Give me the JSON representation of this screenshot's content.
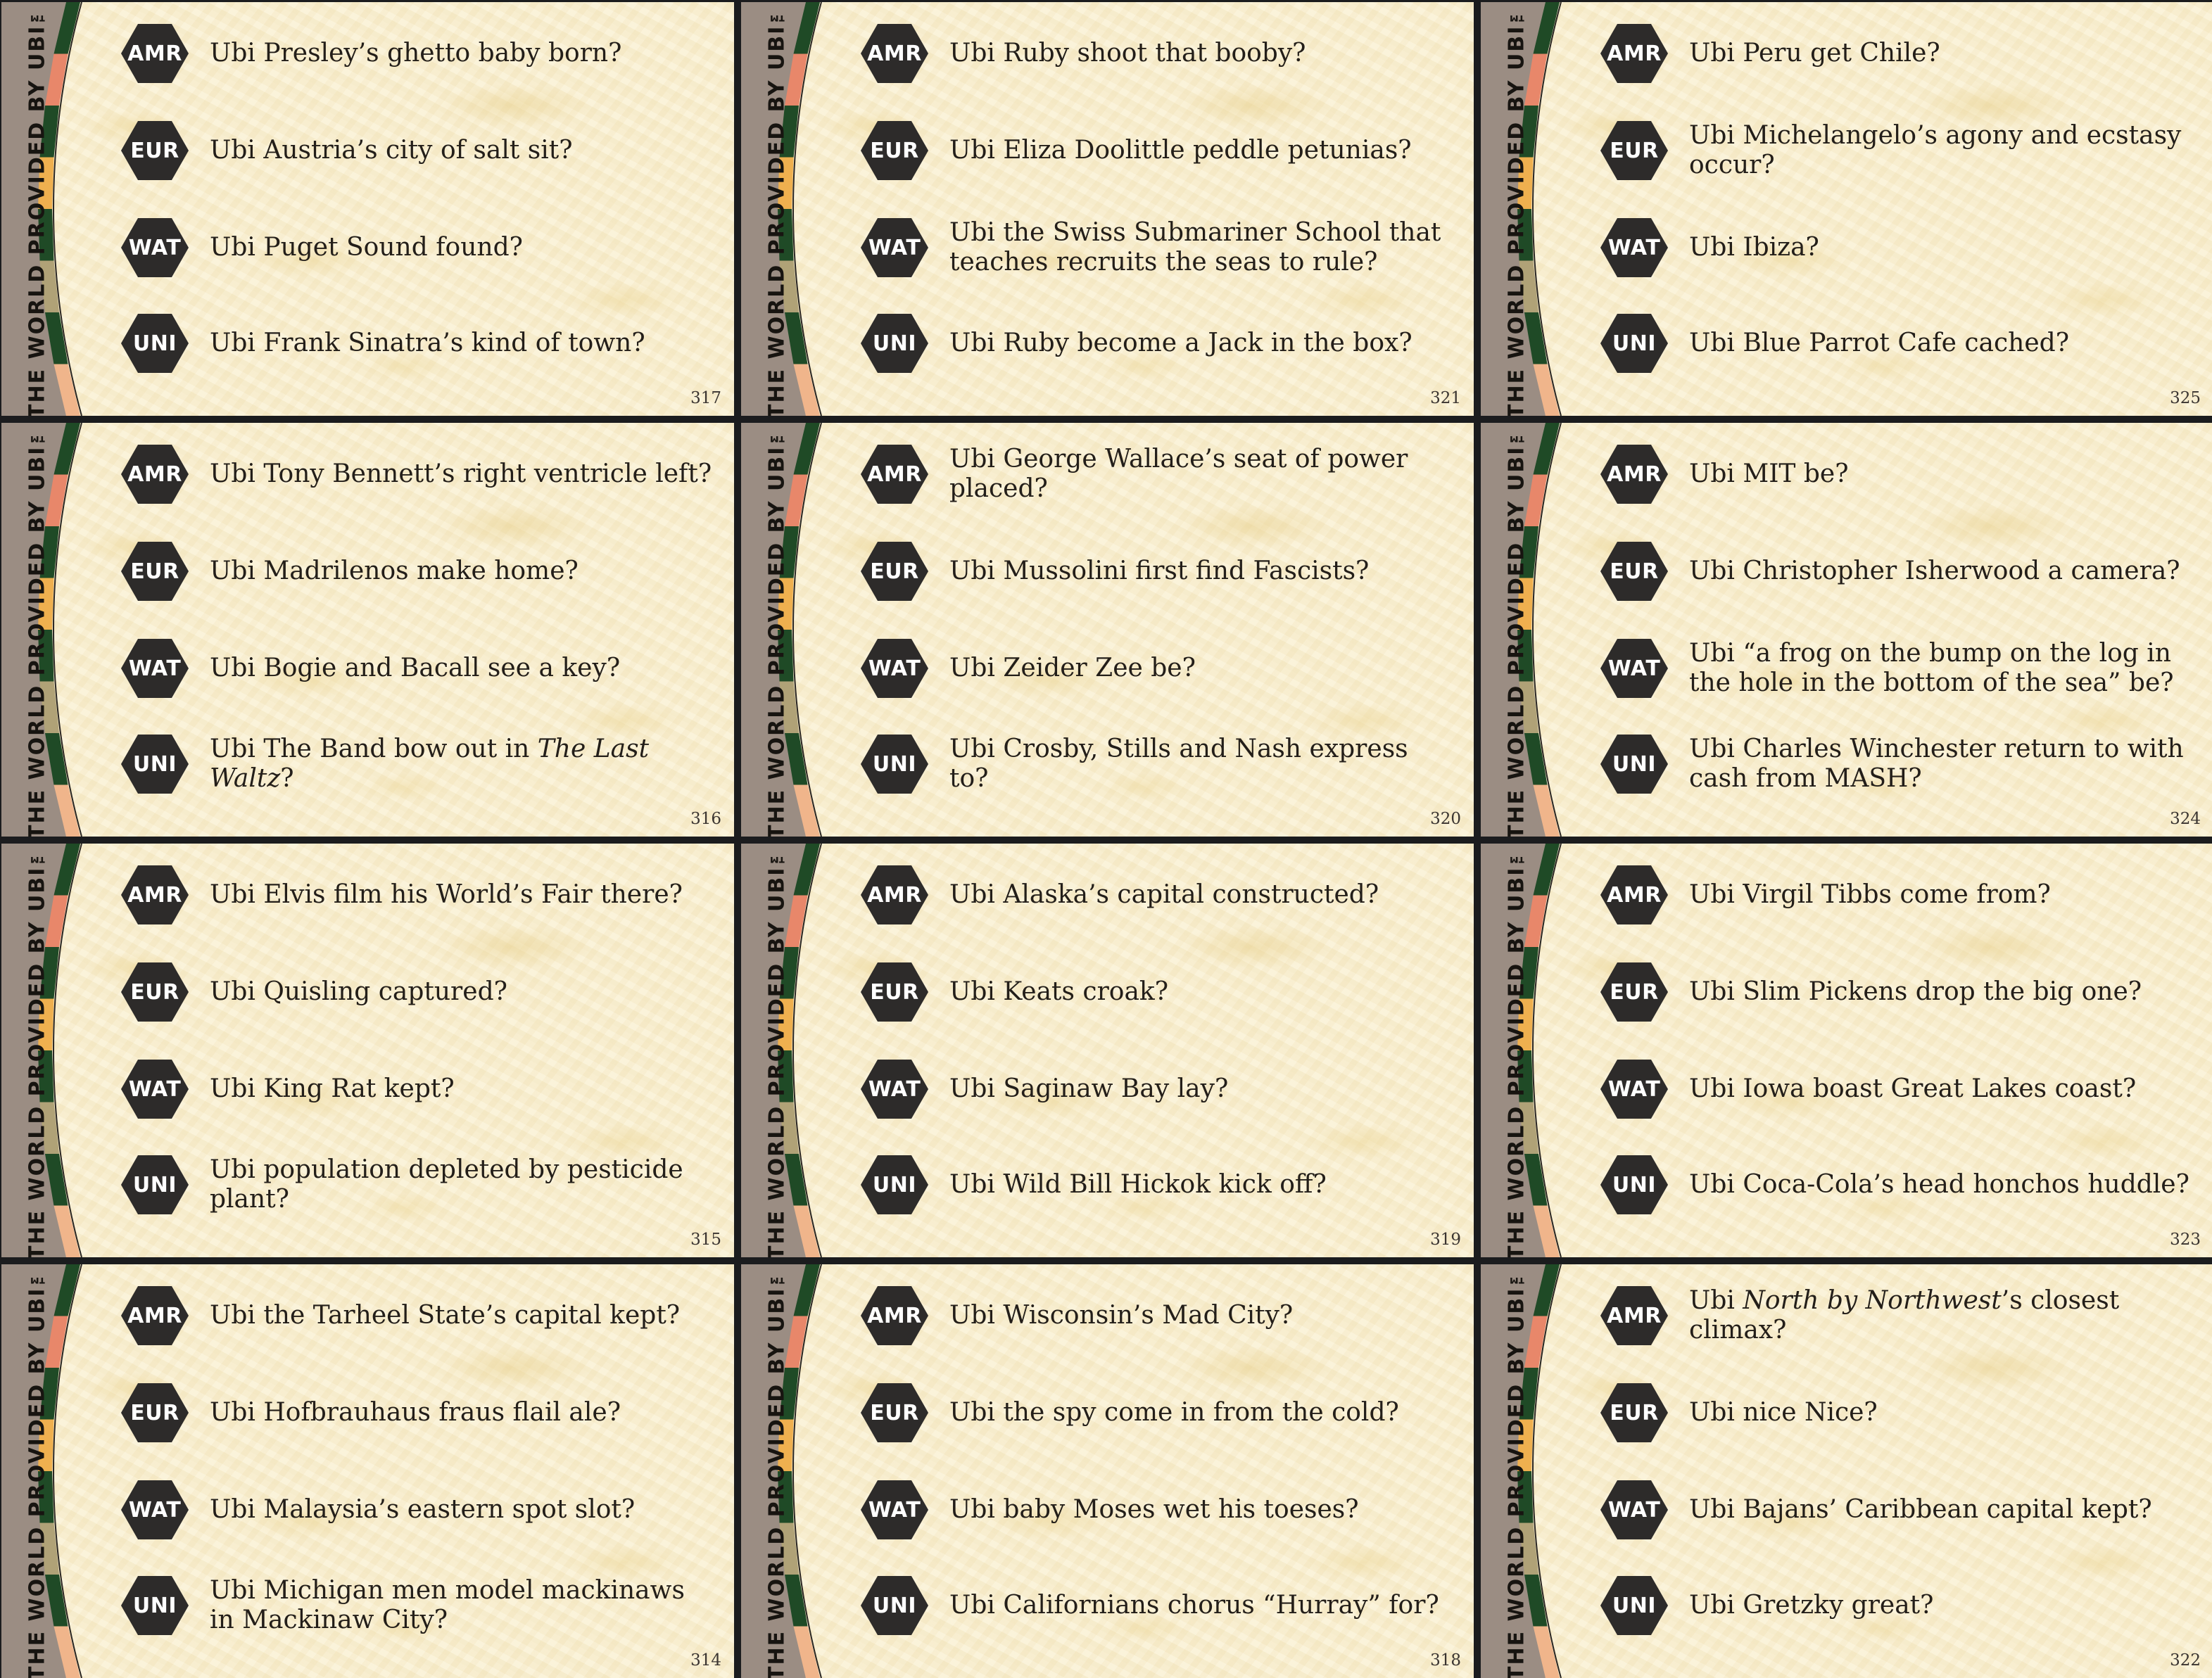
{
  "spine_title": "THE WORLD PROVIDED BY UBI™",
  "category_codes": [
    "AMR",
    "EUR",
    "WAT",
    "UNI"
  ],
  "colors": {
    "spine_brown": "#9b8d83",
    "band_green": "#1f4a26",
    "band_salmon": "#e8876a",
    "band_orange": "#efb04f",
    "band_khaki": "#b0a277",
    "band_peach": "#f0b58b",
    "hex_fill": "#2d2b2a",
    "card_bg": "#faf1d6"
  },
  "cards": [
    {
      "number": "317",
      "questions": [
        {
          "code": "AMR",
          "text": "Ubi Presley’s ghetto baby born?"
        },
        {
          "code": "EUR",
          "text": "Ubi Austria’s city of salt sit?"
        },
        {
          "code": "WAT",
          "text": "Ubi Puget Sound found?"
        },
        {
          "code": "UNI",
          "text": "Ubi Frank Sinatra’s kind of town?"
        }
      ]
    },
    {
      "number": "321",
      "questions": [
        {
          "code": "AMR",
          "text": "Ubi Ruby shoot that booby?"
        },
        {
          "code": "EUR",
          "text": "Ubi Eliza Doolittle peddle petunias?"
        },
        {
          "code": "WAT",
          "text": "Ubi the Swiss Submariner School that teaches recruits the seas to rule?"
        },
        {
          "code": "UNI",
          "text": "Ubi Ruby become a Jack in the box?"
        }
      ]
    },
    {
      "number": "325",
      "questions": [
        {
          "code": "AMR",
          "text": "Ubi Peru get Chile?"
        },
        {
          "code": "EUR",
          "text": "Ubi Michelangelo’s agony and ecstasy occur?"
        },
        {
          "code": "WAT",
          "text": "Ubi Ibiza?"
        },
        {
          "code": "UNI",
          "text": "Ubi Blue Parrot Cafe cached?"
        }
      ]
    },
    {
      "number": "316",
      "questions": [
        {
          "code": "AMR",
          "text": "Ubi Tony Bennett’s right ventricle left?"
        },
        {
          "code": "EUR",
          "text": "Ubi Madrilenos make home?"
        },
        {
          "code": "WAT",
          "text": "Ubi Bogie and Bacall see a key?"
        },
        {
          "code": "UNI",
          "text": "Ubi The Band bow out in The Last Waltz?",
          "italic": "The Last Waltz"
        }
      ]
    },
    {
      "number": "320",
      "questions": [
        {
          "code": "AMR",
          "text": "Ubi George Wallace’s seat of power placed?"
        },
        {
          "code": "EUR",
          "text": "Ubi Mussolini first find Fascists?"
        },
        {
          "code": "WAT",
          "text": "Ubi Zeider Zee be?"
        },
        {
          "code": "UNI",
          "text": "Ubi Crosby, Stills and Nash express to?"
        }
      ]
    },
    {
      "number": "324",
      "questions": [
        {
          "code": "AMR",
          "text": "Ubi MIT be?"
        },
        {
          "code": "EUR",
          "text": "Ubi Christopher Isherwood a camera?"
        },
        {
          "code": "WAT",
          "text": "Ubi “a frog on the bump on the log  in the hole in the bottom of the sea” be?"
        },
        {
          "code": "UNI",
          "text": "Ubi Charles Winchester return to with cash from MASH?"
        }
      ]
    },
    {
      "number": "315",
      "questions": [
        {
          "code": "AMR",
          "text": "Ubi Elvis film his World’s Fair there?"
        },
        {
          "code": "EUR",
          "text": "Ubi Quisling captured?"
        },
        {
          "code": "WAT",
          "text": "Ubi King Rat kept?"
        },
        {
          "code": "UNI",
          "text": "Ubi population depleted by pesticide plant?"
        }
      ]
    },
    {
      "number": "319",
      "questions": [
        {
          "code": "AMR",
          "text": "Ubi Alaska’s capital constructed?"
        },
        {
          "code": "EUR",
          "text": "Ubi Keats croak?"
        },
        {
          "code": "WAT",
          "text": "Ubi Saginaw Bay lay?"
        },
        {
          "code": "UNI",
          "text": "Ubi Wild Bill Hickok kick off?"
        }
      ]
    },
    {
      "number": "323",
      "questions": [
        {
          "code": "AMR",
          "text": "Ubi Virgil Tibbs come from?"
        },
        {
          "code": "EUR",
          "text": "Ubi Slim Pickens drop the big one?"
        },
        {
          "code": "WAT",
          "text": "Ubi Iowa boast Great Lakes coast?"
        },
        {
          "code": "UNI",
          "text": "Ubi Coca-Cola’s head honchos huddle?"
        }
      ]
    },
    {
      "number": "314",
      "questions": [
        {
          "code": "AMR",
          "text": "Ubi the Tarheel State’s capital kept?"
        },
        {
          "code": "EUR",
          "text": "Ubi Hofbrauhaus fraus flail ale?"
        },
        {
          "code": "WAT",
          "text": "Ubi Malaysia’s eastern spot slot?"
        },
        {
          "code": "UNI",
          "text": "Ubi Michigan men model mackinaws in Mackinaw City?"
        }
      ]
    },
    {
      "number": "318",
      "questions": [
        {
          "code": "AMR",
          "text": "Ubi Wisconsin’s Mad City?"
        },
        {
          "code": "EUR",
          "text": "Ubi the spy come in from the cold?"
        },
        {
          "code": "WAT",
          "text": "Ubi baby Moses wet his toeses?"
        },
        {
          "code": "UNI",
          "text": "Ubi Californians chorus “Hurray” for?"
        }
      ]
    },
    {
      "number": "322",
      "questions": [
        {
          "code": "AMR",
          "text": "Ubi North by Northwest’s closest climax?",
          "italic": "North by Northwest"
        },
        {
          "code": "EUR",
          "text": "Ubi nice Nice?"
        },
        {
          "code": "WAT",
          "text": "Ubi Bajans’ Caribbean capital kept?"
        },
        {
          "code": "UNI",
          "text": "Ubi Gretzky great?"
        }
      ]
    }
  ]
}
